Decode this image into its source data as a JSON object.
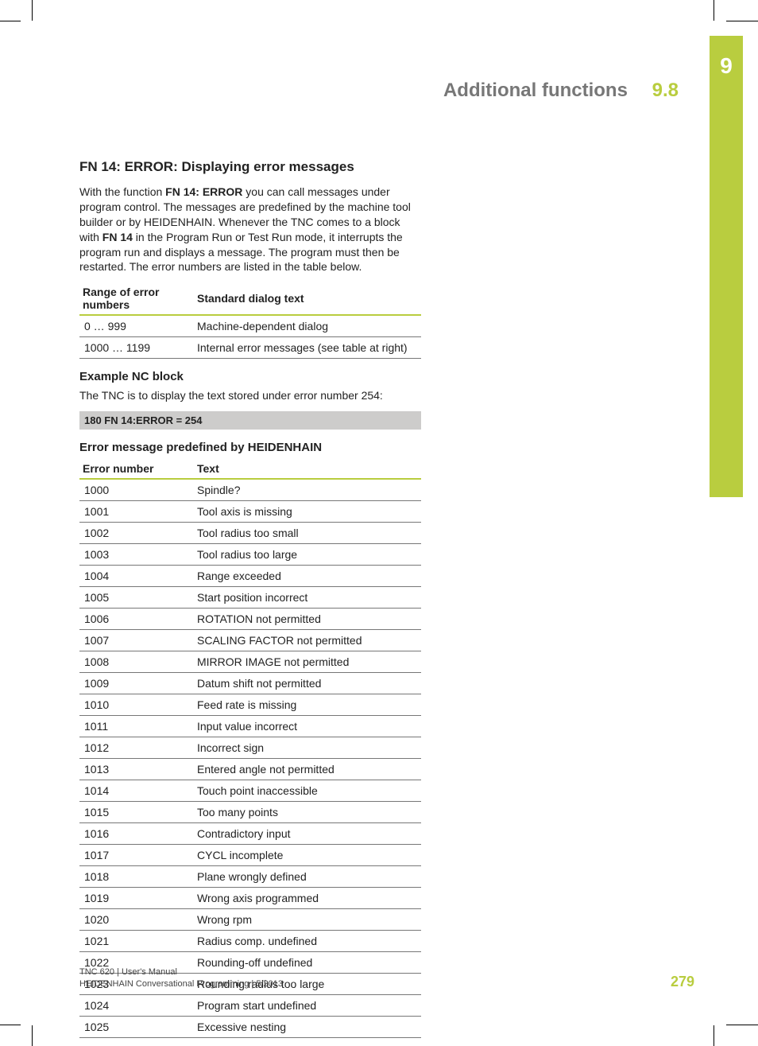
{
  "chapter_number": "9",
  "header": {
    "section_title": "Additional functions",
    "section_number": "9.8"
  },
  "heading": "FN 14: ERROR: Displaying error messages",
  "intro": {
    "pre1": "With the function ",
    "bold1": "FN 14: ERROR",
    "post1": " you can call messages under program control. The messages are predefined by the machine tool builder or by HEIDENHAIN. Whenever the TNC comes to a block with ",
    "bold2": "FN 14",
    "post2": " in the Program Run or Test Run mode, it interrupts the program run and displays a message. The program must then be restarted. The error numbers are listed in the table below."
  },
  "range_table": {
    "headers": [
      "Range of error numbers",
      "Standard dialog text"
    ],
    "rows": [
      [
        "0 … 999",
        "Machine-dependent dialog"
      ],
      [
        "1000 … 1199",
        "Internal error messages (see table at right)"
      ]
    ]
  },
  "example": {
    "title": "Example NC block",
    "text": "The TNC is to display the text stored under error number 254:",
    "code": "180 FN 14:ERROR = 254"
  },
  "error_table": {
    "title": "Error message predefined by HEIDENHAIN",
    "headers": [
      "Error number",
      "Text"
    ],
    "rows": [
      [
        "1000",
        "Spindle?"
      ],
      [
        "1001",
        "Tool axis is missing"
      ],
      [
        "1002",
        "Tool radius too small"
      ],
      [
        "1003",
        "Tool radius too large"
      ],
      [
        "1004",
        "Range exceeded"
      ],
      [
        "1005",
        "Start position incorrect"
      ],
      [
        "1006",
        "ROTATION not permitted"
      ],
      [
        "1007",
        "SCALING FACTOR not permitted"
      ],
      [
        "1008",
        "MIRROR IMAGE not permitted"
      ],
      [
        "1009",
        "Datum shift not permitted"
      ],
      [
        "1010",
        "Feed rate is missing"
      ],
      [
        "1011",
        "Input value incorrect"
      ],
      [
        "1012",
        "Incorrect sign"
      ],
      [
        "1013",
        "Entered angle not permitted"
      ],
      [
        "1014",
        "Touch point inaccessible"
      ],
      [
        "1015",
        "Too many points"
      ],
      [
        "1016",
        "Contradictory input"
      ],
      [
        "1017",
        "CYCL incomplete"
      ],
      [
        "1018",
        "Plane wrongly defined"
      ],
      [
        "1019",
        "Wrong axis programmed"
      ],
      [
        "1020",
        "Wrong rpm"
      ],
      [
        "1021",
        "Radius comp. undefined"
      ],
      [
        "1022",
        "Rounding-off undefined"
      ],
      [
        "1023",
        "Rounding radius too large"
      ],
      [
        "1024",
        "Program start undefined"
      ],
      [
        "1025",
        "Excessive nesting"
      ]
    ]
  },
  "footer": {
    "line1": "TNC 620 | User's Manual",
    "line2": "HEIDENHAIN Conversational Programming | 5/2013"
  },
  "page_number": "279"
}
